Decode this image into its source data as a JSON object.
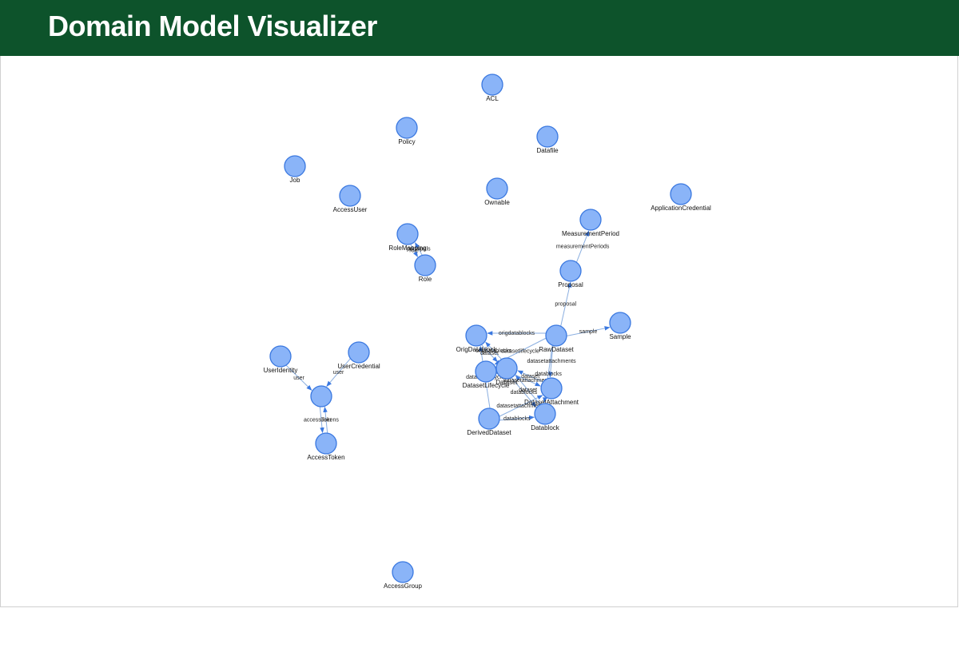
{
  "header": {
    "title": "Domain Model Visualizer",
    "background": "#0d532b"
  },
  "graph": {
    "node_fill": "#8ab4f8",
    "node_stroke": "#3a78e0",
    "edge_color": "#8aaee0",
    "arrow_color": "#3a78e0",
    "nodes": [
      {
        "id": "ACL",
        "label": "ACL"
      },
      {
        "id": "Policy",
        "label": "Policy"
      },
      {
        "id": "Datafile",
        "label": "Datafile"
      },
      {
        "id": "Job",
        "label": "Job"
      },
      {
        "id": "Ownable",
        "label": "Ownable"
      },
      {
        "id": "AccessUser",
        "label": "AccessUser"
      },
      {
        "id": "ApplicationCredential",
        "label": "ApplicationCredential"
      },
      {
        "id": "MeasurementPeriod",
        "label": "MeasurementPeriod"
      },
      {
        "id": "RoleMapping",
        "label": "RoleMapping"
      },
      {
        "id": "Role",
        "label": "Role"
      },
      {
        "id": "Proposal",
        "label": "Proposal"
      },
      {
        "id": "Sample",
        "label": "Sample"
      },
      {
        "id": "OrigDatablock",
        "label": "OrigDatablock"
      },
      {
        "id": "RawDataset",
        "label": "RawDataset"
      },
      {
        "id": "DatasetLifecycle",
        "label": "DatasetLifecycle"
      },
      {
        "id": "Dataset",
        "label": "Dataset"
      },
      {
        "id": "DatasetAttachment",
        "label": "DatasetAttachment"
      },
      {
        "id": "Datablock",
        "label": "Datablock"
      },
      {
        "id": "DerivedDataset",
        "label": "DerivedDataset"
      },
      {
        "id": "UserIdentity",
        "label": "UserIdentity"
      },
      {
        "id": "UserCredential",
        "label": "UserCredential"
      },
      {
        "id": "User",
        "label": ""
      },
      {
        "id": "AccessToken",
        "label": "AccessToken"
      },
      {
        "id": "AccessGroup",
        "label": "AccessGroup"
      }
    ],
    "edges": [
      {
        "source": "Proposal",
        "target": "MeasurementPeriod",
        "label": "measurementPeriods"
      },
      {
        "source": "RawDataset",
        "target": "Proposal",
        "label": "proposal"
      },
      {
        "source": "RawDataset",
        "target": "Sample",
        "label": "sample"
      },
      {
        "source": "RawDataset",
        "target": "OrigDatablock",
        "label": "origdatablocks"
      },
      {
        "source": "RawDataset",
        "target": "DatasetLifecycle",
        "label": "datasetlifecycle"
      },
      {
        "source": "RawDataset",
        "target": "DatasetAttachment",
        "label": "datasetattachments"
      },
      {
        "source": "RawDataset",
        "target": "Datablock",
        "label": "datablocks"
      },
      {
        "source": "OrigDatablock",
        "target": "Dataset",
        "label": "dataset"
      },
      {
        "source": "DatasetLifecycle",
        "target": "Dataset",
        "label": "dataset"
      },
      {
        "source": "DatasetAttachment",
        "target": "Dataset",
        "label": "dataset"
      },
      {
        "source": "Datablock",
        "target": "Dataset",
        "label": "dataset"
      },
      {
        "source": "Dataset",
        "target": "OrigDatablock",
        "label": "origdatablocks"
      },
      {
        "source": "Dataset",
        "target": "DatasetAttachment",
        "label": "datasetattachments"
      },
      {
        "source": "Dataset",
        "target": "Datablock",
        "label": "datablocks"
      },
      {
        "source": "DerivedDataset",
        "target": "OrigDatablock",
        "label": "datasetlifecycle"
      },
      {
        "source": "DerivedDataset",
        "target": "DatasetAttachment",
        "label": "datasetattachments"
      },
      {
        "source": "DerivedDataset",
        "target": "Datablock",
        "label": "datablocks"
      },
      {
        "source": "RoleMapping",
        "target": "Role",
        "label": "role"
      },
      {
        "source": "Role",
        "target": "RoleMapping",
        "label": "principals"
      },
      {
        "source": "UserIdentity",
        "target": "User",
        "label": "user"
      },
      {
        "source": "UserCredential",
        "target": "User",
        "label": "user"
      },
      {
        "source": "User",
        "target": "AccessToken",
        "label": "accessTokens"
      },
      {
        "source": "AccessToken",
        "target": "User",
        "label": "user"
      }
    ]
  }
}
